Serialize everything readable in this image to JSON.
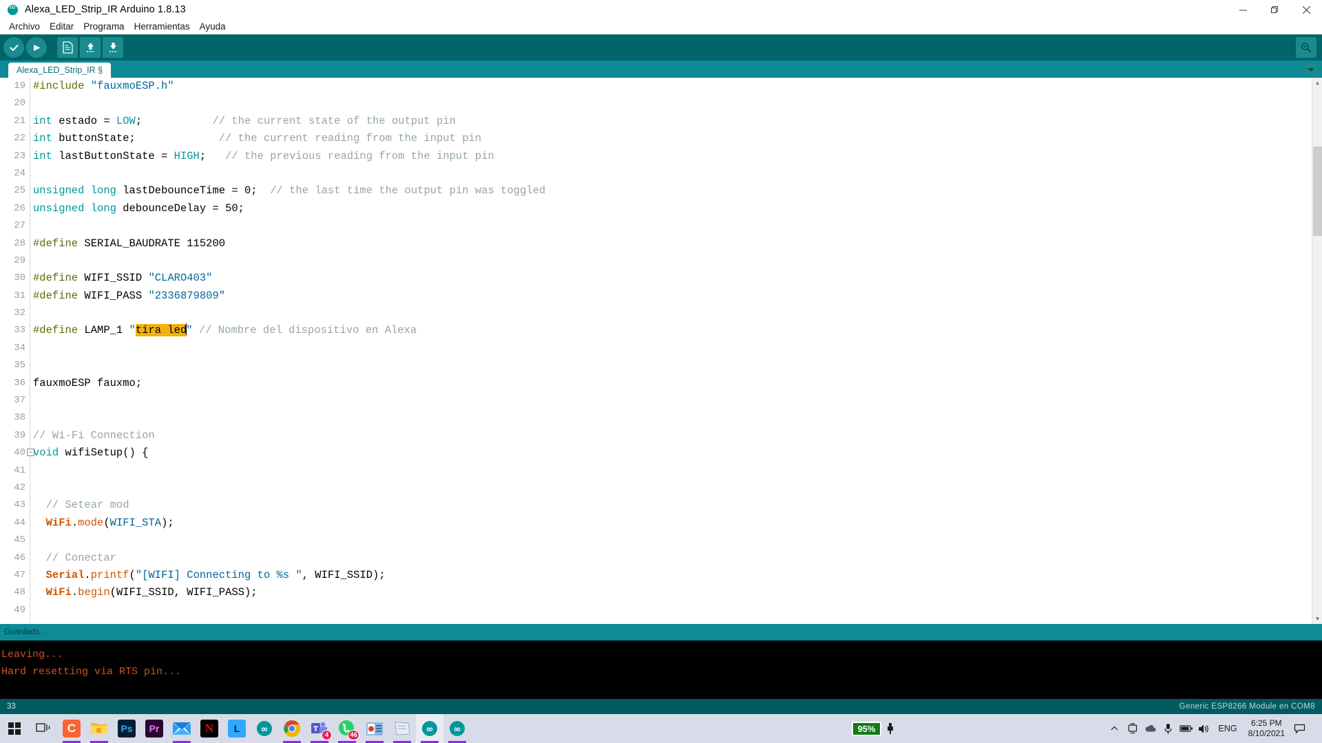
{
  "window": {
    "title": "Alexa_LED_Strip_IR Arduino 1.8.13",
    "app_icon": "arduino-icon",
    "minimize": "minimize-icon",
    "maximize": "restore-icon",
    "close": "close-icon"
  },
  "menu": {
    "items": [
      {
        "label": "Archivo"
      },
      {
        "label": "Editar"
      },
      {
        "label": "Programa"
      },
      {
        "label": "Herramientas"
      },
      {
        "label": "Ayuda"
      }
    ]
  },
  "toolbar": {
    "verify": "verify-icon",
    "upload": "upload-icon",
    "new": "new-sketch-icon",
    "open": "open-sketch-icon",
    "save": "save-sketch-icon",
    "serial_monitor": "serial-monitor-icon"
  },
  "tabs": {
    "active": "Alexa_LED_Strip_IR §",
    "dropdown": "tab-menu-icon"
  },
  "editor": {
    "first_visible_line": 19,
    "selection_text": "tira led",
    "selection_color": "#f3b20c",
    "lines": [
      {
        "n": 19,
        "tokens": [
          {
            "t": "#include ",
            "c": "pre"
          },
          {
            "t": "\"fauxmoESP.h\"",
            "c": "str"
          }
        ]
      },
      {
        "n": 20,
        "tokens": []
      },
      {
        "n": 21,
        "tokens": [
          {
            "t": "int",
            "c": "kw"
          },
          {
            "t": " estado = ",
            "c": "plain"
          },
          {
            "t": "LOW",
            "c": "kw"
          },
          {
            "t": ";           ",
            "c": "plain"
          },
          {
            "t": "// the current state of the output pin",
            "c": "cmt"
          }
        ]
      },
      {
        "n": 22,
        "tokens": [
          {
            "t": "int",
            "c": "kw"
          },
          {
            "t": " buttonState;             ",
            "c": "plain"
          },
          {
            "t": "// the current reading from the input pin",
            "c": "cmt"
          }
        ]
      },
      {
        "n": 23,
        "tokens": [
          {
            "t": "int",
            "c": "kw"
          },
          {
            "t": " lastButtonState = ",
            "c": "plain"
          },
          {
            "t": "HIGH",
            "c": "kw"
          },
          {
            "t": ";   ",
            "c": "plain"
          },
          {
            "t": "// the previous reading from the input pin",
            "c": "cmt"
          }
        ]
      },
      {
        "n": 24,
        "tokens": []
      },
      {
        "n": 25,
        "tokens": [
          {
            "t": "unsigned",
            "c": "kw"
          },
          {
            "t": " ",
            "c": "plain"
          },
          {
            "t": "long",
            "c": "kw"
          },
          {
            "t": " lastDebounceTime = 0;  ",
            "c": "plain"
          },
          {
            "t": "// the last time the output pin was toggled",
            "c": "cmt"
          }
        ]
      },
      {
        "n": 26,
        "tokens": [
          {
            "t": "unsigned",
            "c": "kw"
          },
          {
            "t": " ",
            "c": "plain"
          },
          {
            "t": "long",
            "c": "kw"
          },
          {
            "t": " debounceDelay = 50;",
            "c": "plain"
          }
        ]
      },
      {
        "n": 27,
        "tokens": []
      },
      {
        "n": 28,
        "tokens": [
          {
            "t": "#define",
            "c": "pre"
          },
          {
            "t": " SERIAL_BAUDRATE 115200",
            "c": "plain"
          }
        ]
      },
      {
        "n": 29,
        "tokens": []
      },
      {
        "n": 30,
        "tokens": [
          {
            "t": "#define",
            "c": "pre"
          },
          {
            "t": " WIFI_SSID ",
            "c": "plain"
          },
          {
            "t": "\"CLARO403\"",
            "c": "str"
          }
        ]
      },
      {
        "n": 31,
        "tokens": [
          {
            "t": "#define",
            "c": "pre"
          },
          {
            "t": " WIFI_PASS ",
            "c": "plain"
          },
          {
            "t": "\"2336879809\"",
            "c": "str"
          }
        ]
      },
      {
        "n": 32,
        "tokens": []
      },
      {
        "n": 33,
        "tokens": [
          {
            "t": "#define",
            "c": "pre"
          },
          {
            "t": " LAMP_1 ",
            "c": "plain"
          },
          {
            "t": "\"",
            "c": "str"
          },
          {
            "t": "tira led",
            "c": "sel"
          },
          {
            "t": "|",
            "c": "caret"
          },
          {
            "t": "\"",
            "c": "str"
          },
          {
            "t": " ",
            "c": "plain"
          },
          {
            "t": "// Nombre del dispositivo en Alexa",
            "c": "cmt"
          }
        ]
      },
      {
        "n": 34,
        "tokens": []
      },
      {
        "n": 35,
        "tokens": []
      },
      {
        "n": 36,
        "tokens": [
          {
            "t": "fauxmoESP fauxmo;",
            "c": "plain"
          }
        ]
      },
      {
        "n": 37,
        "tokens": []
      },
      {
        "n": 38,
        "tokens": []
      },
      {
        "n": 39,
        "tokens": [
          {
            "t": "// Wi-Fi Connection",
            "c": "cmt"
          }
        ]
      },
      {
        "n": 40,
        "fold": true,
        "tokens": [
          {
            "t": "void",
            "c": "kw"
          },
          {
            "t": " wifiSetup() {",
            "c": "plain"
          }
        ]
      },
      {
        "n": 41,
        "tokens": []
      },
      {
        "n": 42,
        "tokens": []
      },
      {
        "n": 43,
        "tokens": [
          {
            "t": "  // Setear mod",
            "c": "cmt"
          }
        ]
      },
      {
        "n": 44,
        "tokens": [
          {
            "t": "  ",
            "c": "plain"
          },
          {
            "t": "WiFi",
            "c": "cls"
          },
          {
            "t": ".",
            "c": "plain"
          },
          {
            "t": "mode",
            "c": "fn"
          },
          {
            "t": "(",
            "c": "plain"
          },
          {
            "t": "WIFI_STA",
            "c": "str"
          },
          {
            "t": ");",
            "c": "plain"
          }
        ]
      },
      {
        "n": 45,
        "tokens": []
      },
      {
        "n": 46,
        "tokens": [
          {
            "t": "  // Conectar",
            "c": "cmt"
          }
        ]
      },
      {
        "n": 47,
        "tokens": [
          {
            "t": "  ",
            "c": "plain"
          },
          {
            "t": "Serial",
            "c": "cls"
          },
          {
            "t": ".",
            "c": "plain"
          },
          {
            "t": "printf",
            "c": "fn"
          },
          {
            "t": "(",
            "c": "plain"
          },
          {
            "t": "\"[WIFI] Connecting to %s \"",
            "c": "str"
          },
          {
            "t": ", WIFI_SSID);",
            "c": "plain"
          }
        ]
      },
      {
        "n": 48,
        "tokens": [
          {
            "t": "  ",
            "c": "plain"
          },
          {
            "t": "WiFi",
            "c": "cls"
          },
          {
            "t": ".",
            "c": "plain"
          },
          {
            "t": "begin",
            "c": "fn"
          },
          {
            "t": "(WIFI_SSID, WIFI_PASS);",
            "c": "plain"
          }
        ]
      },
      {
        "n": 49,
        "tokens": []
      }
    ]
  },
  "status": {
    "message": "Guardado."
  },
  "console": {
    "text_color": "#d4511e",
    "lines": [
      "Leaving...",
      "Hard resetting via RTS pin..."
    ]
  },
  "bottom_bar": {
    "line_number": "33",
    "board": "Generic ESP8266 Module en COM8"
  },
  "taskbar": {
    "start": "windows-start-icon",
    "task_view": "task-view-icon",
    "items": [
      {
        "name": "camtasia",
        "label": "C",
        "bg": "#fa6432",
        "color": "#ffffff",
        "running": true
      },
      {
        "name": "file-explorer",
        "label": "",
        "bg": "#ffb900",
        "color": "#ffffff",
        "running": true
      },
      {
        "name": "photoshop",
        "label": "Ps",
        "bg": "#001e36",
        "color": "#31a8ff",
        "running": false
      },
      {
        "name": "premiere-pro",
        "label": "Pr",
        "bg": "#2a0634",
        "color": "#ea77ff",
        "running": false
      },
      {
        "name": "mail",
        "label": "",
        "bg": "#0078d7",
        "color": "#ffffff",
        "running": true
      },
      {
        "name": "netflix",
        "label": "N",
        "bg": "#000000",
        "color": "#e50914",
        "running": false
      },
      {
        "name": "lightroom",
        "label": "L",
        "bg": "#31a8ff",
        "color": "#001e36",
        "running": false
      },
      {
        "name": "arduino-ide",
        "label": "",
        "bg": "#00979c",
        "color": "#ffffff",
        "running": false
      },
      {
        "name": "google-chrome",
        "label": "",
        "bg": "#ffffff",
        "color": "#4285f4",
        "running": true
      },
      {
        "name": "microsoft-teams",
        "label": "T",
        "bg": "#4b53bc",
        "color": "#ffffff",
        "badge": "4",
        "running": true
      },
      {
        "name": "whatsapp",
        "label": "",
        "bg": "#25d366",
        "color": "#ffffff",
        "badge": "46",
        "running": true
      },
      {
        "name": "powerpoint-doc",
        "label": "",
        "bg": "#d24726",
        "color": "#ffffff",
        "running": true
      },
      {
        "name": "notepad",
        "label": "",
        "bg": "#dbe5f1",
        "color": "#7a8599",
        "running": true
      },
      {
        "name": "arduino-ide-window-1",
        "label": "",
        "bg": "#00979c",
        "color": "#ffffff",
        "running": true,
        "active": true
      },
      {
        "name": "arduino-ide-window-2",
        "label": "",
        "bg": "#00979c",
        "color": "#ffffff",
        "running": true
      }
    ],
    "tray": {
      "battery_percent": "95%",
      "charging": "charging-plug-icon",
      "overflow": "show-hidden-icons-icon",
      "icons": [
        "screen-cast-icon",
        "onedrive-icon",
        "microphone-icon",
        "battery-icon",
        "volume-icon"
      ],
      "language": "ENG",
      "time": "6:25 PM",
      "date": "8/10/2021",
      "notifications": "action-center-icon"
    }
  }
}
